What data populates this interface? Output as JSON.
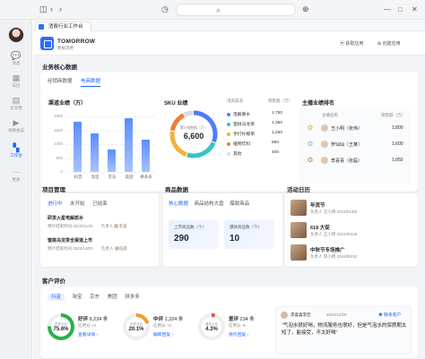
{
  "colors": {
    "accent": "#1f66ff",
    "positive": "#27b148",
    "neutral": "#f39c2b",
    "negative": "#e74c3c"
  },
  "sidebar": {
    "items": [
      {
        "label": "消息",
        "icon": "chat-icon"
      },
      {
        "label": "日历",
        "icon": "calendar-icon"
      },
      {
        "label": "云文档",
        "icon": "docs-icon"
      },
      {
        "label": "视频会议",
        "icon": "video-icon"
      },
      {
        "label": "工作台",
        "icon": "apps-icon",
        "active": true
      },
      {
        "label": "更多",
        "icon": "more-icon"
      }
    ]
  },
  "tab": {
    "title": "消费行业工作台"
  },
  "header": {
    "brand": "TOMORROW",
    "brand_sub": "数据消费",
    "btn1": "获取应用",
    "btn2": "创建应用"
  },
  "business": {
    "title": "业务核心数据",
    "tabs": [
      "经销商数据",
      "电商数据"
    ],
    "chart_title": "渠道业绩（万）",
    "sku_title": "SKU 业绩",
    "rank_title": "主播业绩排名",
    "donut_label": "累计销售额（万）",
    "donut_value": "6,600",
    "legend_header_name": "电商渠道",
    "legend_header_val": "销售额（万）",
    "legend": [
      {
        "name": "电解质水",
        "value": "1,750",
        "color": "#4f7cff"
      },
      {
        "name": "蜜桃乌龙茶",
        "value": "1,350",
        "color": "#36c2c9"
      },
      {
        "name": "手打柠檬茶",
        "value": "1,250",
        "color": "#f2b23a"
      },
      {
        "name": "植物饮料",
        "value": "850",
        "color": "#ec7e34"
      },
      {
        "name": "其他",
        "value": "400",
        "color": "#d9dce1"
      }
    ],
    "rank_header": [
      "主播名称",
      "销售额（万）"
    ],
    "rank": [
      {
        "name": "王小明（张伟）",
        "value": "1,800"
      },
      {
        "name": "罗仙仙（王某）",
        "value": "1,600"
      },
      {
        "name": "李喜喜（张磊）",
        "value": "1,050"
      }
    ]
  },
  "chart_data": {
    "type": "bar",
    "title": "渠道业绩（万）",
    "categories": [
      "抖音",
      "淘宝",
      "京东",
      "美团",
      "拼多多"
    ],
    "values": [
      1800,
      1400,
      800,
      1950,
      1150
    ],
    "ylabels": [
      "2000",
      "1500",
      "1000",
      "500",
      "0"
    ],
    "ylim": [
      0,
      2000
    ]
  },
  "project": {
    "title": "项目管理",
    "tabs": [
      "进行中",
      "未开始",
      "已结束"
    ],
    "items": [
      {
        "name": "研发火星电解质水",
        "date": "预计结束时间 2022/11/20",
        "owner": "负责人",
        "person": "李喜"
      },
      {
        "name": "蜜桃乌龙茶全渠道上市",
        "date": "预计结束时间 2022/12/20",
        "owner": "负责人",
        "person": "张晨"
      }
    ]
  },
  "product": {
    "title": "商品数据",
    "tabs": [
      "核心数据",
      "商品结构大盘",
      "爆款商品"
    ],
    "kpi1_label": "上市商品数（个）",
    "kpi1_value": "290",
    "kpi2_label": "爆款商品数（个）",
    "kpi2_value": "10"
  },
  "activity": {
    "title": "活动日历",
    "items": [
      {
        "name": "年货节",
        "date": "负责人 王小明  2022/01/05"
      },
      {
        "name": "618 大促",
        "date": "负责人 王小明  2022/06/18"
      },
      {
        "name": "中秋节专场推广",
        "date": "负责人 李小明  2022/09/10"
      }
    ]
  },
  "reviews": {
    "title": "客户评价",
    "tabs": [
      "抖音",
      "淘宝",
      "京东",
      "美团",
      "拼多多"
    ],
    "cards": [
      {
        "label": "好评",
        "count": "9,234 条",
        "sub": "信用分 +3",
        "link": "查看详情",
        "pct_label": "好评占比",
        "pct": "75.6%",
        "fraction": 0.756,
        "color": "#27b148"
      },
      {
        "label": "中评",
        "count": "1,324 条",
        "sub": "信用分 +0",
        "link": "跟踪回复",
        "pct_label": "中评占比",
        "pct": "20.1%",
        "fraction": 0.201,
        "color": "#f39c2b"
      },
      {
        "label": "差评",
        "count": "234 条",
        "sub": "信用分 -8",
        "link": "指引回复",
        "pct_label": "差评占比",
        "pct": "4.3%",
        "fraction": 0.043,
        "color": "#e74c3c"
      }
    ],
    "quote": {
      "name": "李喜喜李佳",
      "date": "2022/12/26",
      "btn": "联系客户",
      "text": "“气泡水很好喝，物流服务也很好，但是气泡水的保质期太短了，能接受，不太好喝”"
    }
  }
}
